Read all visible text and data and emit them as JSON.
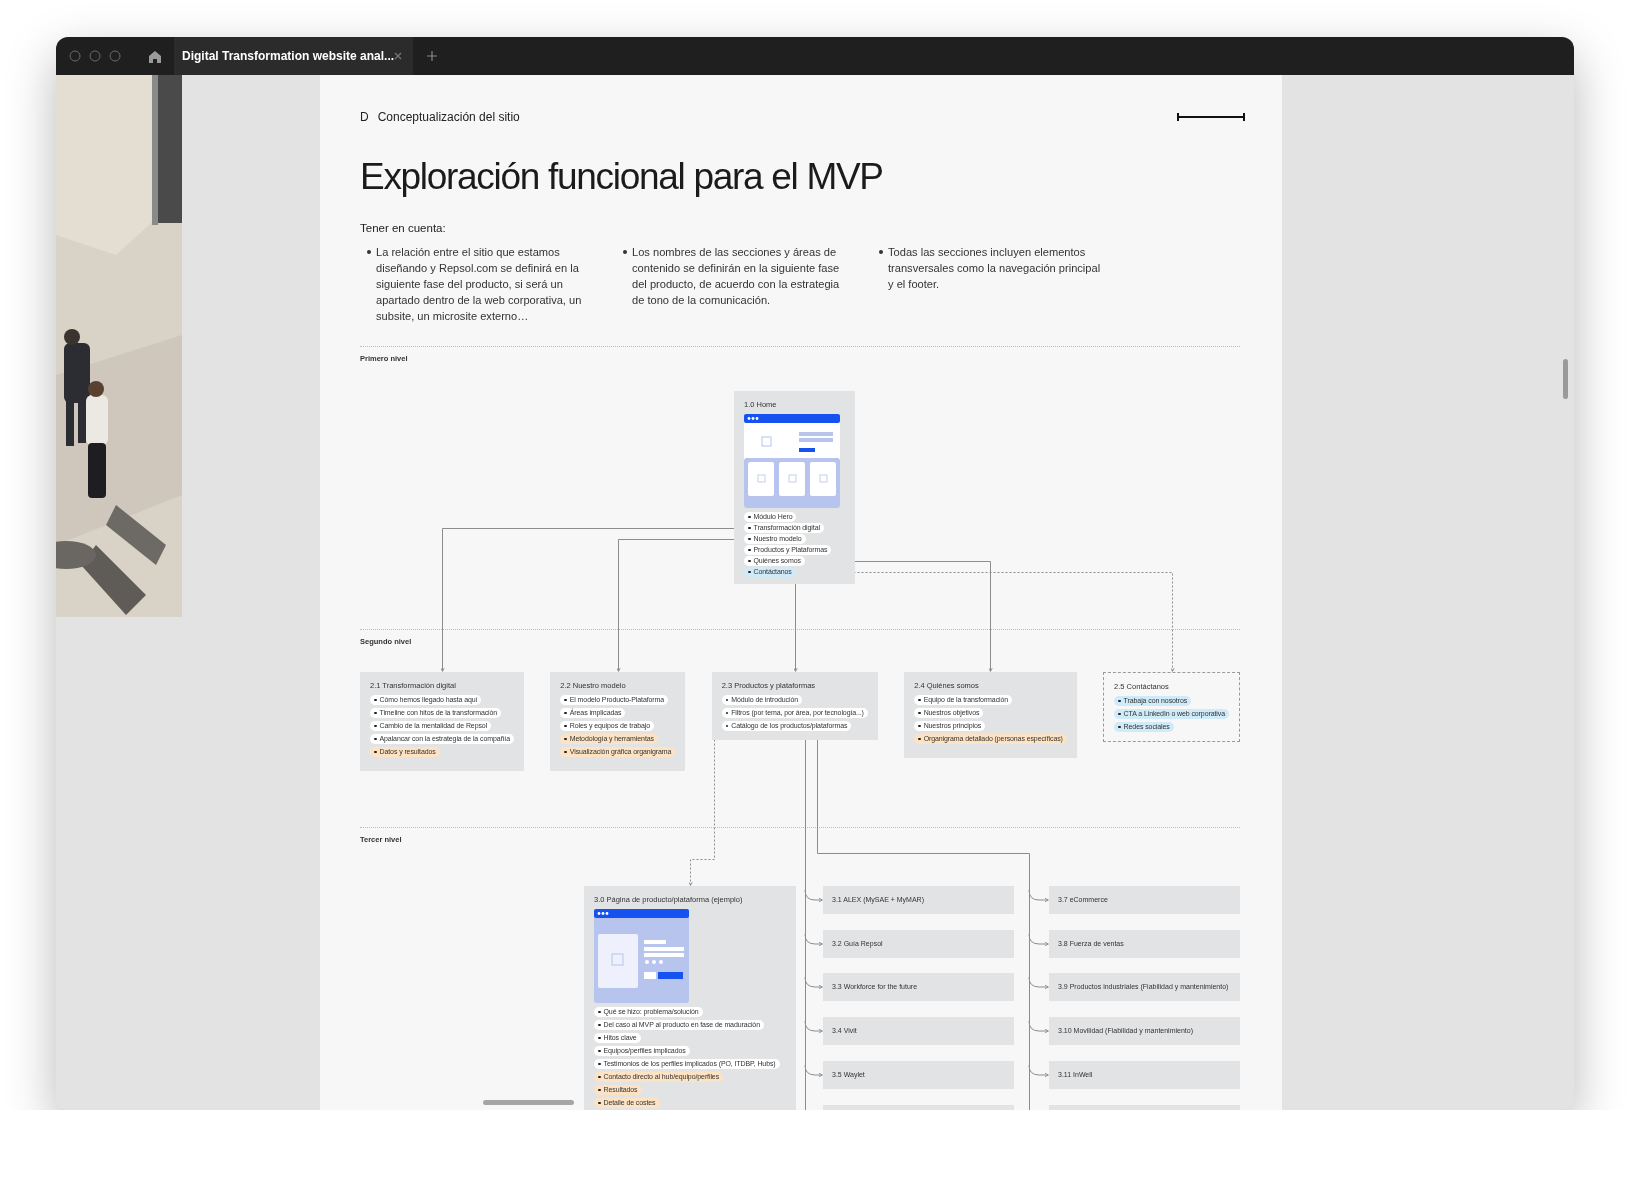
{
  "window": {
    "tab_title": "Digital Transformation website anal..."
  },
  "page": {
    "section_letter": "D",
    "section_title": "Conceptualización del sitio",
    "title": "Exploración funcional para el MVP",
    "note_heading": "Tener en cuenta:",
    "notes": [
      "La relación entre el sitio que estamos diseñando y Repsol.com se definirá en la siguiente fase del producto, si será un apartado dentro de la web corporativa, un subsite, un microsite externo…",
      "Los nombres de las secciones y áreas de contenido se definirán en la siguiente fase del producto, de acuerdo con la estrategia de tono de la comunicación.",
      "Todas las secciones incluyen elementos transversales como la navegación principal y el footer."
    ]
  },
  "diagram": {
    "levels": [
      "Primero nivel",
      "Segundo nivel",
      "Tercer nivel"
    ],
    "home": {
      "title": "1.0 Home",
      "items": [
        {
          "label": "Módulo Hero",
          "color": "#ffffff"
        },
        {
          "label": "Transformación digital",
          "color": "#ffffff"
        },
        {
          "label": "Nuestro modelo",
          "color": "#ffffff"
        },
        {
          "label": "Productos y Plataformas",
          "color": "#ffffff"
        },
        {
          "label": "Quiénes somos",
          "color": "#ffffff"
        },
        {
          "label": "Contáctanos",
          "color": "#cfeaf9"
        }
      ]
    },
    "second_level": [
      {
        "title": "2.1 Transformación digital",
        "dashed": false,
        "items": [
          {
            "label": "Cómo hemos llegado hasta aquí",
            "color": "#ffffff"
          },
          {
            "label": "Timeline con hitos de la transformación",
            "color": "#ffffff"
          },
          {
            "label": "Cambio de la mentalidad de Repsol",
            "color": "#ffffff"
          },
          {
            "label": "Apalancar con la estrategia de la compañía",
            "color": "#ffffff"
          },
          {
            "label": "Datos y resultados",
            "color": "#fde3c4"
          }
        ]
      },
      {
        "title": "2.2 Nuestro modelo",
        "dashed": false,
        "items": [
          {
            "label": "El modelo Producto-Plataforma",
            "color": "#ffffff"
          },
          {
            "label": "Áreas implicadas",
            "color": "#ffffff"
          },
          {
            "label": "Roles y equipos de trabajo",
            "color": "#ffffff"
          },
          {
            "label": "Metodología y herramientas",
            "color": "#fde3c4"
          },
          {
            "label": "Visualización gráfica organigrama",
            "color": "#fde3c4"
          }
        ]
      },
      {
        "title": "2.3 Productos y plataformas",
        "dashed": false,
        "items": [
          {
            "label": "Módulo de introdución",
            "color": "#ffffff"
          },
          {
            "label": "Filtros (por tema, por área, por tecnología...)",
            "color": "#ffffff"
          },
          {
            "label": "Catálogo de los productos/plataformas",
            "color": "#ffffff"
          }
        ]
      },
      {
        "title": "2.4 Quiénes somos",
        "dashed": false,
        "items": [
          {
            "label": "Equipo de la transformación",
            "color": "#ffffff"
          },
          {
            "label": "Nuestros objetivos",
            "color": "#ffffff"
          },
          {
            "label": "Nuestros principios",
            "color": "#ffffff"
          },
          {
            "label": "Organigrama detallado (personas específicas)",
            "color": "#fde3c4"
          }
        ]
      },
      {
        "title": "2.5 Contáctanos",
        "dashed": true,
        "items": [
          {
            "label": "Trabaja con nosotros",
            "color": "#cfeaf9"
          },
          {
            "label": "CTA a LinkedIn o web corporativa",
            "color": "#cfeaf9"
          },
          {
            "label": "Redes sociales",
            "color": "#cfeaf9"
          }
        ]
      }
    ],
    "product_page": {
      "title": "3.0 Página de producto/plataforma (ejemplo)",
      "items": [
        {
          "label": "Qué se hizo: problema/solución",
          "color": "#ffffff"
        },
        {
          "label": "Del caso al MVP al producto en fase de maduración",
          "color": "#ffffff"
        },
        {
          "label": "Hitos clave",
          "color": "#ffffff"
        },
        {
          "label": "Equipos/perfiles implicados",
          "color": "#ffffff"
        },
        {
          "label": "Testimonios de los perfiles implicados (PO, ITDBP, Hubs)",
          "color": "#ffffff"
        },
        {
          "label": "Contacto directo al hub/equipo/perfiles",
          "color": "#fde3c4"
        },
        {
          "label": "Resultados",
          "color": "#fde3c4"
        },
        {
          "label": "Detalle de costes",
          "color": "#fde3c4"
        }
      ]
    },
    "third_level_columns": [
      [
        {
          "kind": "node",
          "label": "3.1 ALEX (MySAE + MyMAR)"
        },
        {
          "kind": "node",
          "label": "3.2 Guía Repsol"
        },
        {
          "kind": "node",
          "label": "3.3 Workforce for the future"
        },
        {
          "kind": "node",
          "label": "3.4 Vivit"
        },
        {
          "kind": "node",
          "label": "3.5 Waylet"
        },
        {
          "kind": "partial"
        }
      ],
      [
        {
          "kind": "node",
          "label": "3.7 eCommerce"
        },
        {
          "kind": "node",
          "label": "3.8 Fuerza de ventas"
        },
        {
          "kind": "node",
          "label": "3.9 Productos industriales (Fiabilidad y mantenimiento)"
        },
        {
          "kind": "node",
          "label": "3.10 Movilidad (Fiabilidad y mantenimiento)"
        },
        {
          "kind": "node",
          "label": "3.11 InWell"
        },
        {
          "kind": "partial"
        }
      ]
    ]
  }
}
